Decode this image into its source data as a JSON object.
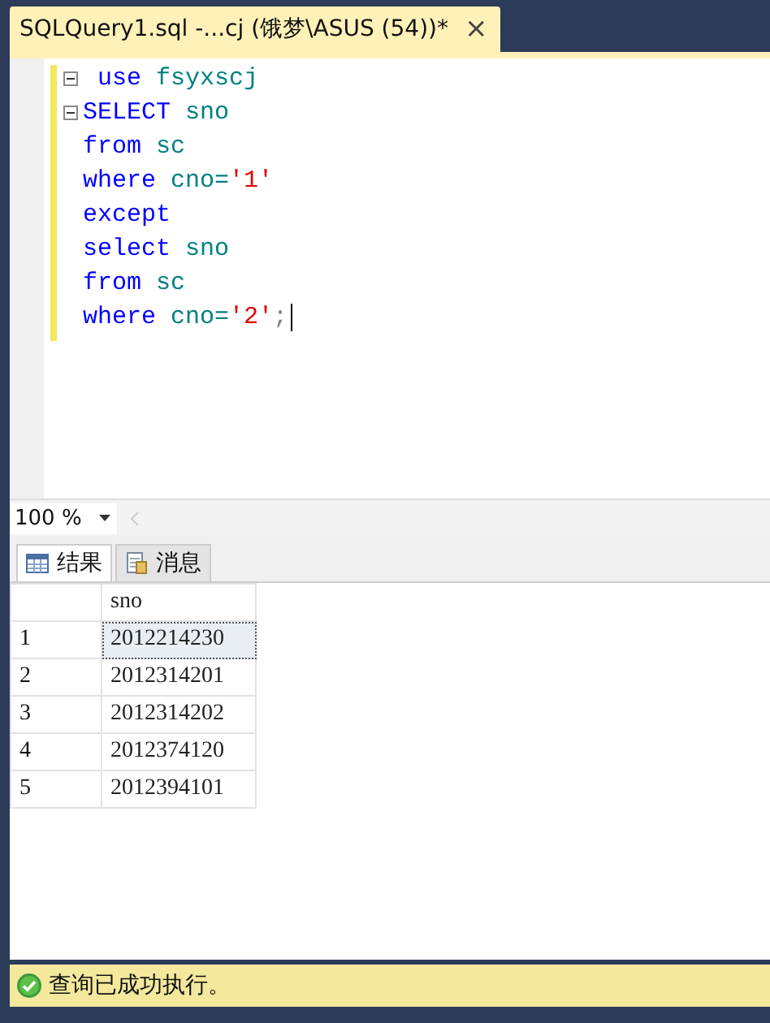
{
  "document_tab": {
    "title": "SQLQuery1.sql -...cj (饿梦\\ASUS (54))*",
    "close": "×",
    "selected": true
  },
  "editor": {
    "lines": [
      {
        "fold": true,
        "tokens": [
          {
            "kind": "keyword",
            "text": " use"
          },
          {
            "kind": "ident",
            "text": " fsyxscj"
          }
        ]
      },
      {
        "fold": true,
        "tokens": [
          {
            "kind": "keyword",
            "text": "SELECT"
          },
          {
            "kind": "ident",
            "text": " sno"
          }
        ]
      },
      {
        "fold": false,
        "tokens": [
          {
            "kind": "keyword",
            "text": "from"
          },
          {
            "kind": "ident",
            "text": " sc"
          }
        ]
      },
      {
        "fold": false,
        "tokens": [
          {
            "kind": "keyword",
            "text": "where"
          },
          {
            "kind": "ident",
            "text": " cno="
          },
          {
            "kind": "string",
            "text": "'1'"
          }
        ]
      },
      {
        "fold": false,
        "tokens": [
          {
            "kind": "keyword",
            "text": "except"
          }
        ]
      },
      {
        "fold": false,
        "tokens": [
          {
            "kind": "keyword",
            "text": "select"
          },
          {
            "kind": "ident",
            "text": " sno"
          }
        ]
      },
      {
        "fold": false,
        "tokens": [
          {
            "kind": "keyword",
            "text": "from"
          },
          {
            "kind": "ident",
            "text": " sc"
          }
        ]
      },
      {
        "fold": false,
        "cursor": true,
        "tokens": [
          {
            "kind": "keyword",
            "text": "where"
          },
          {
            "kind": "ident",
            "text": " cno="
          },
          {
            "kind": "string",
            "text": "'2'"
          },
          {
            "kind": "punct",
            "text": ";"
          }
        ]
      }
    ]
  },
  "zoom": {
    "value": "100 %"
  },
  "result_tabs": [
    {
      "label": "结果",
      "kind": "grid",
      "selected": true
    },
    {
      "label": "消息",
      "kind": "messages",
      "selected": false
    }
  ],
  "grid": {
    "columns": [
      "sno"
    ],
    "rows": [
      {
        "number": "1",
        "cells": [
          "2012214230"
        ],
        "selected": true
      },
      {
        "number": "2",
        "cells": [
          "2012314201"
        ],
        "selected": false
      },
      {
        "number": "3",
        "cells": [
          "2012314202"
        ],
        "selected": false
      },
      {
        "number": "4",
        "cells": [
          "2012374120"
        ],
        "selected": false
      },
      {
        "number": "5",
        "cells": [
          "2012394101"
        ],
        "selected": false
      }
    ]
  },
  "status_bar": {
    "kind": "success",
    "message": "查询已成功执行。"
  }
}
